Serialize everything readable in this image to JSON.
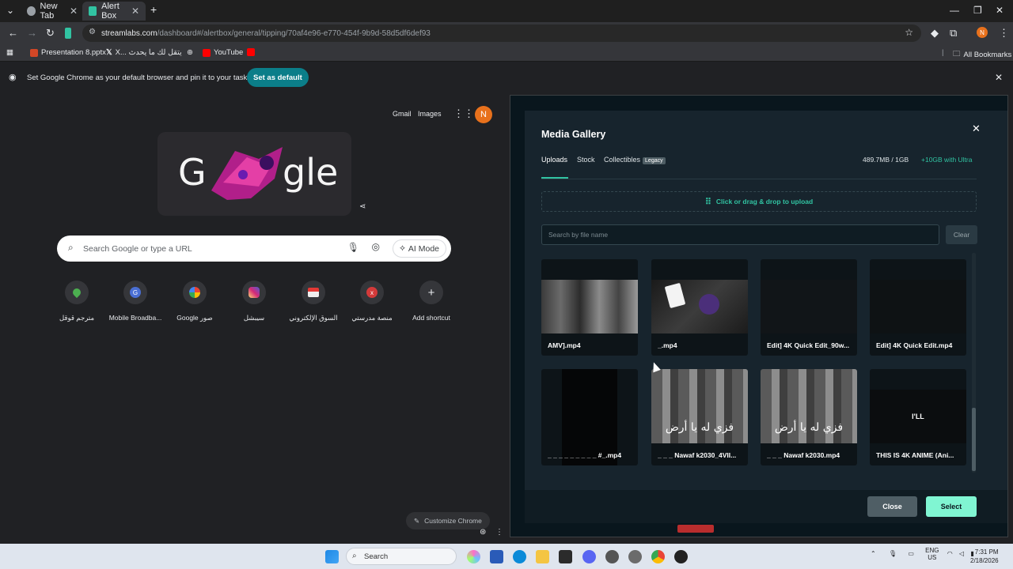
{
  "browser": {
    "tabs": [
      {
        "title": "New Tab",
        "active": false
      },
      {
        "title": "Alert Box",
        "active": true
      }
    ],
    "url_host": "streamlabs.com",
    "url_path": "/dashboard#/alertbox/general/tipping/70af4e96-e770-454f-9b9d-58d5df6def93",
    "bookmarks": [
      "Presentation 8.pptx",
      "X... يتقل لك ما يحدث",
      "YouTube"
    ],
    "all_bookmarks": "All Bookmarks",
    "profile_initial": "N",
    "infobar_text": "Set Google Chrome as your default browser and pin it to your taskbar",
    "set_default": "Set as default"
  },
  "newtab": {
    "gmail": "Gmail",
    "images": "Images",
    "profile_initial": "N",
    "doodle_left": "G",
    "doodle_right": "gle",
    "search_placeholder": "Search Google or type a URL",
    "ai_mode": "AI Mode",
    "shortcuts": [
      {
        "label": "مترجم قوقل",
        "icon": "maps-icon",
        "color": "#4caf50"
      },
      {
        "label": "Mobile Broadba...",
        "icon": "g-icon",
        "color": "#4a6fd4"
      },
      {
        "label": "Google صور",
        "icon": "google-icon",
        "color": "#ffffff"
      },
      {
        "label": "سيبشل",
        "icon": "instagram-icon",
        "color": "#d62976"
      },
      {
        "label": "السوق الإلكتروني",
        "icon": "store-icon",
        "color": "#cccccc"
      },
      {
        "label": "منصة مدرستي",
        "icon": "x-icon",
        "color": "#d33a3a"
      },
      {
        "label": "Add shortcut",
        "icon": "plus-icon",
        "color": "#35363a"
      }
    ],
    "customize": "Customize Chrome"
  },
  "media_gallery": {
    "title": "Media Gallery",
    "tabs": [
      "Uploads",
      "Stock",
      "Collectibles"
    ],
    "legacy_badge": "Legacy",
    "usage": "489.7MB / 1GB",
    "ultra": "+10GB with Ultra",
    "upload_prompt": "Click or drag & drop to upload",
    "search_placeholder": "Search by file name",
    "clear": "Clear",
    "files": [
      {
        "name": "AMV].mp4",
        "thumb": "street"
      },
      {
        "name": "_.mp4",
        "thumb": "cards"
      },
      {
        "name": "Edit] 4K Quick Edit_90w...",
        "thumb": "dark"
      },
      {
        "name": "Edit] 4K Quick Edit.mp4",
        "thumb": "dark"
      },
      {
        "name": "_ _ _ _ _ _ _ _ _ #_.mp4",
        "thumb": "black"
      },
      {
        "name": "_ _ _ Nawaf k2030_4VII...",
        "thumb": "crowd",
        "overlay": "فزي له يا أرض"
      },
      {
        "name": "_ _ _ Nawaf k2030.mp4",
        "thumb": "crowd",
        "overlay": "فزي له يا أرض"
      },
      {
        "name": "THIS IS 4K ANIME (Ani...",
        "thumb": "text",
        "overlay": "I'LL"
      }
    ],
    "close": "Close",
    "select": "Select"
  },
  "taskbar": {
    "search": "Search",
    "lang_top": "ENG",
    "lang_bottom": "US",
    "time": "7:31 PM",
    "date": "2/18/2026"
  }
}
